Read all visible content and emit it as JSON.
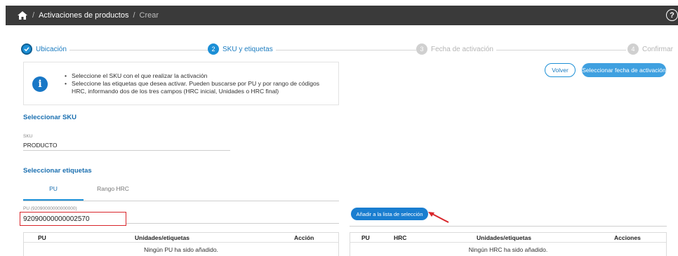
{
  "topbar": {
    "breadcrumb_section": "Activaciones de productos",
    "breadcrumb_current": "Crear",
    "separator": "/",
    "help_glyph": "?",
    "icons": [
      "home-icon",
      "help-icon"
    ]
  },
  "stepper": {
    "steps": [
      {
        "number": "",
        "label": "Ubicación",
        "state": "done"
      },
      {
        "number": "2",
        "label": "SKU y etiquetas",
        "state": "current"
      },
      {
        "number": "3",
        "label": "Fecha de activación",
        "state": "pending"
      },
      {
        "number": "4",
        "label": "Confirmar",
        "state": "pending"
      }
    ]
  },
  "info": {
    "icon_glyph": "i",
    "bullets": [
      "Seleccione el SKU con el que realizar la activación",
      "Seleccione las etiquetas que desea activar. Pueden buscarse por PU y por rango de códigos HRC, informando dos de los tres campos (HRC inicial, Unidades o HRC final)"
    ]
  },
  "actions": {
    "back_label": "Volver",
    "next_label": "Seleccionar fecha de activación"
  },
  "sku_section": {
    "title": "Seleccionar SKU",
    "field_label": "SKU",
    "field_value": "PRODUCTO"
  },
  "labels_section": {
    "title": "Seleccionar etiquetas",
    "tabs": [
      "PU",
      "Rango HRC"
    ],
    "active_tab": "PU",
    "pu_field_label": "PU (92090000000000000)",
    "pu_field_value": "92090000000002570",
    "add_button_label": "Añadir a la lista de selección"
  },
  "pu_table": {
    "columns": [
      "PU",
      "Unidades/etiquetas",
      "Acción"
    ],
    "empty_message": "Ningún PU ha sido añadido."
  },
  "hrc_table": {
    "columns": [
      "PU",
      "HRC",
      "Unidades/etiquetas",
      "Acciones"
    ],
    "empty_message": "Ningún HRC ha sido añadido."
  },
  "colors": {
    "topbar_bg": "#3a3a3a",
    "accent": "#1c8fd6",
    "highlight_border": "#d9262b"
  }
}
